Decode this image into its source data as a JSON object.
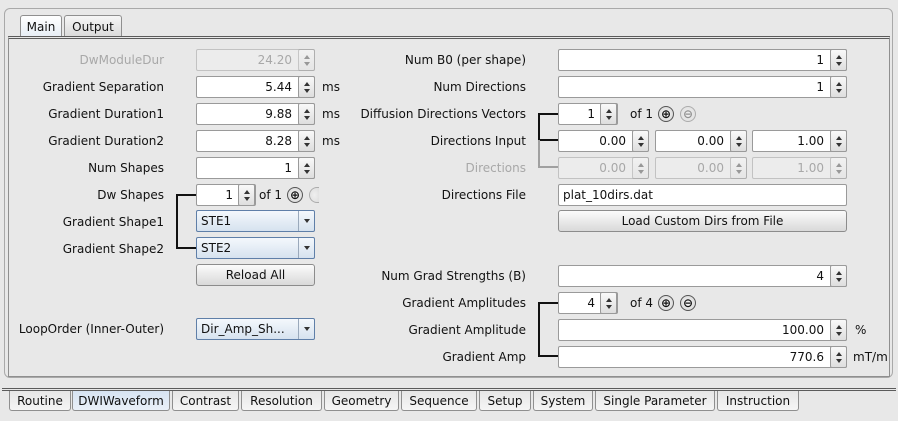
{
  "top_tabs": [
    "Main",
    "Output"
  ],
  "left": {
    "dw_module_dur": {
      "label": "DwModuleDur",
      "value": "24.20"
    },
    "gradient_separation": {
      "label": "Gradient Separation",
      "value": "5.44",
      "unit": "ms"
    },
    "gradient_duration1": {
      "label": "Gradient Duration1",
      "value": "9.88",
      "unit": "ms"
    },
    "gradient_duration2": {
      "label": "Gradient Duration2",
      "value": "8.28",
      "unit": "ms"
    },
    "num_shapes": {
      "label": "Num Shapes",
      "value": "1"
    },
    "dw_shapes": {
      "label": "Dw Shapes",
      "value": "1",
      "of_text": "of 1"
    },
    "gradient_shape1": {
      "label": "Gradient Shape1",
      "value": "STE1"
    },
    "gradient_shape2": {
      "label": "Gradient Shape2",
      "value": "STE2"
    },
    "reload_all": "Reload All",
    "loop_order": {
      "label": "LoopOrder (Inner-Outer)",
      "value": "Dir_Amp_Sh..."
    }
  },
  "right": {
    "num_b0": {
      "label": "Num B0 (per shape)",
      "value": "1"
    },
    "num_directions": {
      "label": "Num Directions",
      "value": "1"
    },
    "diffusion_directions_vectors": {
      "label": "Diffusion Directions Vectors",
      "value": "1",
      "of_text": "of 1"
    },
    "directions_input": {
      "label": "Directions Input",
      "values": [
        "0.00",
        "0.00",
        "1.00"
      ]
    },
    "directions": {
      "label": "Directions",
      "values": [
        "0.00",
        "0.00",
        "1.00"
      ]
    },
    "directions_file": {
      "label": "Directions File",
      "value": "plat_10dirs.dat"
    },
    "load_custom_dirs": "Load Custom Dirs from File",
    "num_grad_strengths": {
      "label": "Num Grad Strengths (B)",
      "value": "4"
    },
    "gradient_amplitudes": {
      "label": "Gradient Amplitudes",
      "value": "4",
      "of_text": "of 4"
    },
    "gradient_amplitude": {
      "label": "Gradient Amplitude",
      "value": "100.00",
      "unit": "%"
    },
    "gradient_amp": {
      "label": "Gradient Amp",
      "value": "770.6",
      "unit": "mT/m"
    }
  },
  "bottom_tabs": [
    "Routine",
    "DWIWaveform",
    "Contrast",
    "Resolution",
    "Geometry",
    "Sequence",
    "Setup",
    "System",
    "Single Parameter",
    "Instruction"
  ],
  "icons": {
    "plus": "⊕",
    "minus": "⊖"
  }
}
